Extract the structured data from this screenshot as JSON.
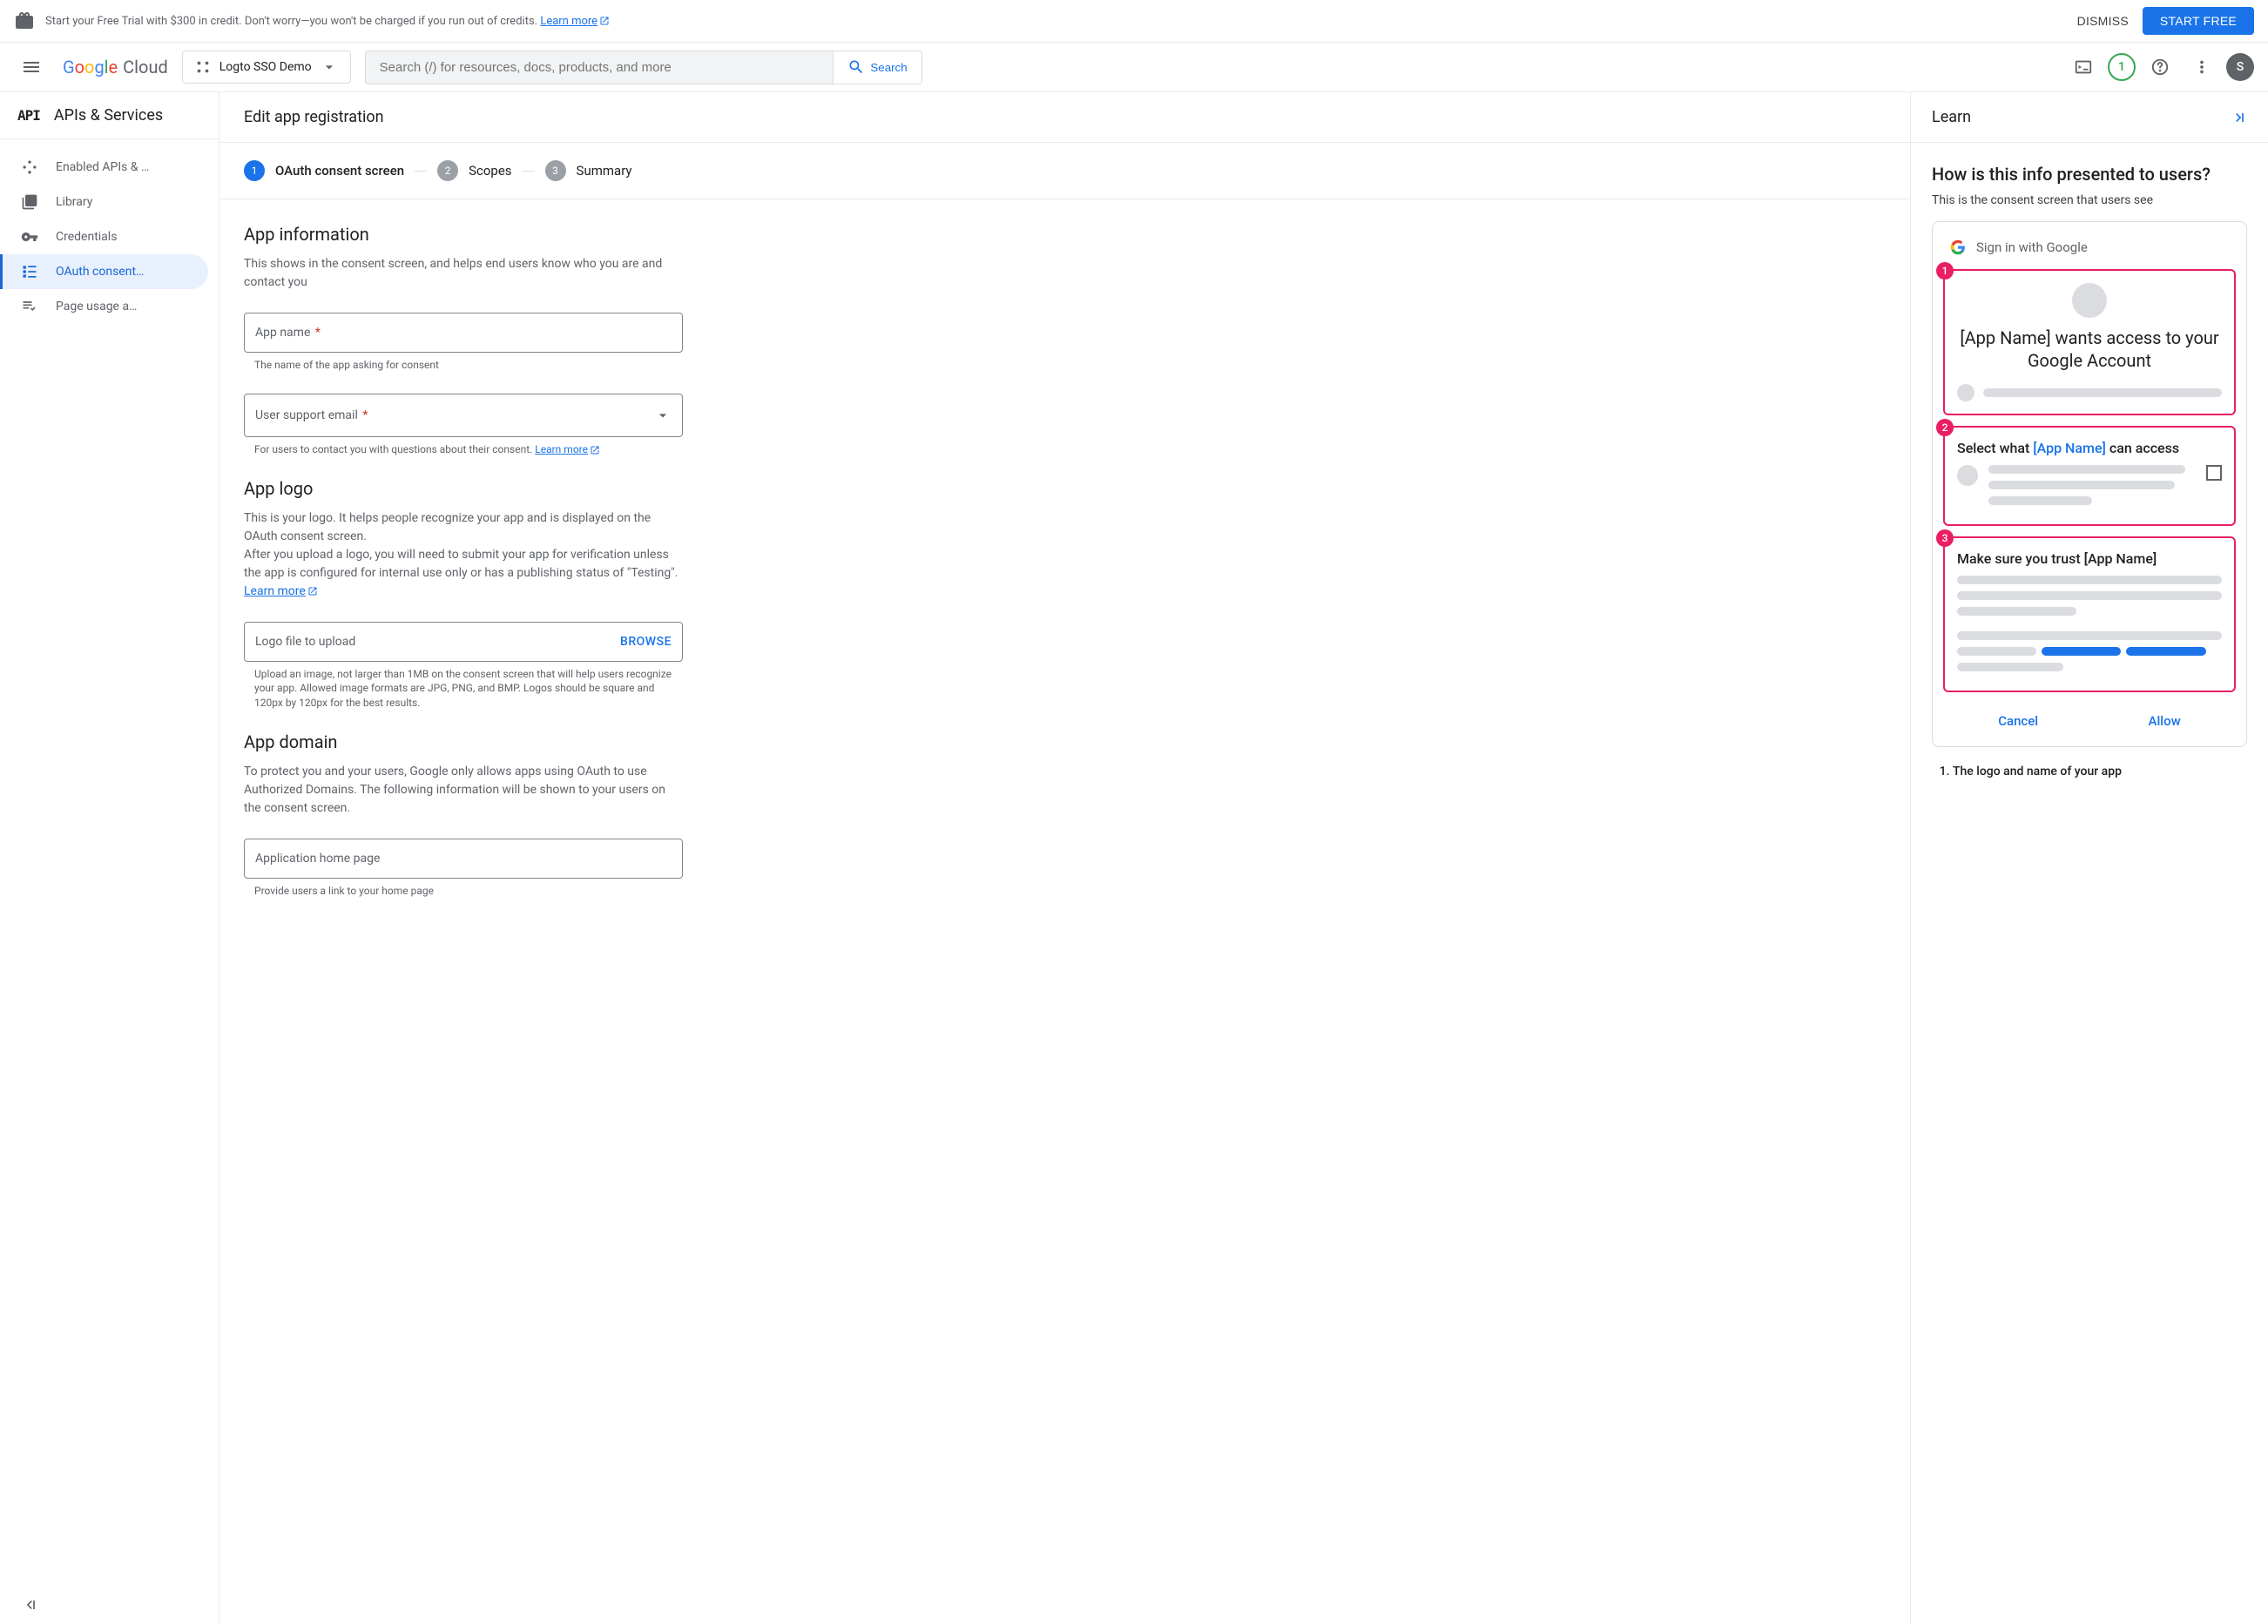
{
  "banner": {
    "text": "Start your Free Trial with $300 in credit. Don't worry—you won't be charged if you run out of credits. ",
    "learn_more": "Learn more",
    "dismiss": "DISMISS",
    "start_free": "START FREE"
  },
  "header": {
    "project_name": "Logto SSO Demo",
    "search_placeholder": "Search (/) for resources, docs, products, and more",
    "search_btn": "Search",
    "trial_count": "1",
    "avatar_initial": "S"
  },
  "sidebar": {
    "title": "APIs & Services",
    "items": [
      {
        "label": "Enabled APIs & …",
        "icon": "dashboard"
      },
      {
        "label": "Library",
        "icon": "library"
      },
      {
        "label": "Credentials",
        "icon": "key"
      },
      {
        "label": "OAuth consent…",
        "icon": "consent",
        "active": true
      },
      {
        "label": "Page usage a…",
        "icon": "agreements"
      }
    ]
  },
  "page": {
    "title": "Edit app registration",
    "steps": [
      {
        "num": "1",
        "label": "OAuth consent screen",
        "active": true
      },
      {
        "num": "2",
        "label": "Scopes"
      },
      {
        "num": "3",
        "label": "Summary"
      }
    ],
    "app_info": {
      "title": "App information",
      "desc": "This shows in the consent screen, and helps end users know who you are and contact you",
      "app_name_label": "App name",
      "app_name_helper": "The name of the app asking for consent",
      "support_email_label": "User support email",
      "support_email_helper": "For users to contact you with questions about their consent. ",
      "learn_more": "Learn more"
    },
    "app_logo": {
      "title": "App logo",
      "desc1": "This is your logo. It helps people recognize your app and is displayed on the OAuth consent screen.",
      "desc2a": "After you upload a logo, you will need to submit your app for verification unless the app is configured for internal use only or has a publishing status of \"Testing\". ",
      "learn_more": "Learn more",
      "upload_label": "Logo file to upload",
      "browse": "BROWSE",
      "upload_helper": "Upload an image, not larger than 1MB on the consent screen that will help users recognize your app. Allowed image formats are JPG, PNG, and BMP. Logos should be square and 120px by 120px for the best results."
    },
    "app_domain": {
      "title": "App domain",
      "desc": "To protect you and your users, Google only allows apps using OAuth to use Authorized Domains. The following information will be shown to your users on the consent screen.",
      "homepage_label": "Application home page",
      "homepage_helper": "Provide users a link to your home page"
    }
  },
  "learn": {
    "title": "Learn",
    "h2": "How is this info presented to users?",
    "sub": "This is the consent screen that users see",
    "signin": "Sign in with Google",
    "card1_title": "[App Name] wants access to your Google Account",
    "card2_prefix": "Select what ",
    "card2_app": "[App Name]",
    "card2_suffix": " can access",
    "card3_title": "Make sure you trust [App Name]",
    "cancel": "Cancel",
    "allow": "Allow",
    "list_1": "The logo and name of your app"
  }
}
